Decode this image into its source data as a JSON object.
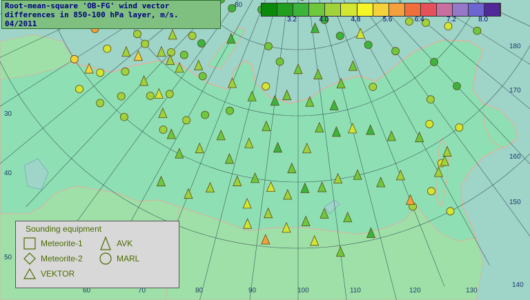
{
  "title": {
    "line1": "Root-mean-square 'OB-FG' wind vector",
    "line2": "differences in 850-100 hPa layer, m/s.",
    "line3": "04/2011"
  },
  "scale": {
    "colors": [
      "#0a8a0a",
      "#1f9e1f",
      "#3cb43c",
      "#6ec83c",
      "#a0d23c",
      "#d2e632",
      "#f5f528",
      "#f5d23c",
      "#f5a03c",
      "#f06e3c",
      "#e6505a",
      "#c86ea0",
      "#9678c8",
      "#6e64d2",
      "#50289a"
    ],
    "labels": [
      "3.2",
      "4.0",
      "4.8",
      "5.6",
      "6.4",
      "7.2",
      "8.0"
    ]
  },
  "geo_labels": {
    "lon": [
      "30",
      "40",
      "50",
      "60",
      "70",
      "80",
      "90",
      "100",
      "110",
      "120",
      "130",
      "140",
      "150",
      "160",
      "170",
      "180"
    ],
    "lat": [
      "80",
      "40",
      "50"
    ]
  },
  "legend": {
    "title": "Sounding equipment",
    "meteorite1": "Meteorite-1",
    "meteorite2": "Meteorite-2",
    "vektor": "VEKTOR",
    "avk": "AVK",
    "marl": "MARL"
  },
  "stations": {
    "circles": [
      {
        "lon": 20,
        "lat": 75,
        "c": "#3cb43c"
      },
      {
        "lon": 95,
        "lat": 80,
        "c": "#6e3cb4"
      },
      {
        "lon": 57,
        "lat": 80,
        "c": "#3cb43c"
      },
      {
        "lon": 60,
        "lat": 77,
        "c": "#3cb43c"
      },
      {
        "lon": 55,
        "lat": 77,
        "c": "#3cb43c"
      },
      {
        "lon": 50,
        "lat": 73,
        "c": "#3cb43c"
      },
      {
        "lon": 45,
        "lat": 75,
        "c": "#6ec83c"
      },
      {
        "lon": 40,
        "lat": 73,
        "c": "#3cb43c"
      },
      {
        "lon": 35,
        "lat": 72,
        "c": "#6ec83c"
      },
      {
        "lon": 70,
        "lat": 75,
        "c": "#3cb43c"
      },
      {
        "lon": 82,
        "lat": 70,
        "c": "#6ec83c"
      },
      {
        "lon": 104,
        "lat": 78,
        "c": "#3cb43c"
      },
      {
        "lon": 120,
        "lat": 74,
        "c": "#3cb43c"
      },
      {
        "lon": 127,
        "lat": 71,
        "c": "#3cb43c"
      },
      {
        "lon": 140,
        "lat": 68,
        "c": "#3cb43c"
      },
      {
        "lon": 150,
        "lat": 65,
        "c": "#6ec83c"
      },
      {
        "lon": 170,
        "lat": 65,
        "c": "#a0d23c"
      },
      {
        "lon": 165,
        "lat": 67,
        "c": "#a0d23c"
      },
      {
        "lon": 175,
        "lat": 62,
        "c": "#d2e632"
      },
      {
        "lon": 180,
        "lat": 58,
        "c": "#6ec83c"
      },
      {
        "lon": 160,
        "lat": 60,
        "c": "#3cb43c"
      },
      {
        "lon": 150,
        "lat": 56,
        "c": "#a0d23c"
      },
      {
        "lon": 160,
        "lat": 55,
        "c": "#3cb43c"
      },
      {
        "lon": 145,
        "lat": 53,
        "c": "#d2e632"
      },
      {
        "lon": 152,
        "lat": 50,
        "c": "#d2e632"
      },
      {
        "lon": 142,
        "lat": 47,
        "c": "#d2e632"
      },
      {
        "lon": 136,
        "lat": 44,
        "c": "#d2e632"
      },
      {
        "lon": 138,
        "lat": 40,
        "c": "#d2e632"
      },
      {
        "lon": 130,
        "lat": 43,
        "c": "#a0d23c"
      },
      {
        "lon": 40,
        "lat": 62,
        "c": "#a0d23c"
      },
      {
        "lon": 30,
        "lat": 60,
        "c": "#a0d23c"
      },
      {
        "lon": 33,
        "lat": 55,
        "c": "#a0d23c"
      },
      {
        "lon": 38,
        "lat": 52,
        "c": "#a0d23c"
      },
      {
        "lon": 28,
        "lat": 48,
        "c": "#d2e632"
      },
      {
        "lon": 35,
        "lat": 49,
        "c": "#a0d23c"
      },
      {
        "lon": 43,
        "lat": 50,
        "c": "#a0d23c"
      },
      {
        "lon": 45,
        "lat": 55,
        "c": "#a0d23c"
      },
      {
        "lon": 50,
        "lat": 57,
        "c": "#a0d23c"
      },
      {
        "lon": 55,
        "lat": 52,
        "c": "#a0d23c"
      },
      {
        "lon": 60,
        "lat": 55,
        "c": "#a0d23c"
      },
      {
        "lon": 65,
        "lat": 57,
        "c": "#6ec83c"
      },
      {
        "lon": 73,
        "lat": 59,
        "c": "#6ec83c"
      },
      {
        "lon": 85,
        "lat": 64,
        "c": "#d2e632"
      },
      {
        "lon": 90,
        "lat": 68,
        "c": "#6ec83c"
      },
      {
        "lon": 57,
        "lat": 62,
        "c": "#6ec83c"
      },
      {
        "lon": 48,
        "lat": 66,
        "c": "#3cb43c"
      },
      {
        "lon": 45,
        "lat": 63,
        "c": "#6ec83c"
      },
      {
        "lon": 42,
        "lat": 66,
        "c": "#a0d23c"
      },
      {
        "lon": 38,
        "lat": 70,
        "c": "#6ec83c"
      },
      {
        "lon": 30,
        "lat": 66,
        "c": "#a0d23c"
      },
      {
        "lon": 25,
        "lat": 60,
        "c": "#a0d23c"
      },
      {
        "lon": 23,
        "lat": 55,
        "c": "#d2e632"
      },
      {
        "lon": 20,
        "lat": 50,
        "c": "#f5d23c"
      },
      {
        "lon": 28,
        "lat": 52,
        "c": "#d2e632"
      },
      {
        "lon": 15,
        "lat": 55,
        "c": "#f5a03c"
      },
      {
        "lon": 133,
        "lat": 62,
        "c": "#a0d23c"
      }
    ],
    "triangles": [
      {
        "lon": 18,
        "lat": 71,
        "c": "#6ec83c"
      },
      {
        "lon": 40,
        "lat": 70,
        "c": "#3cb43c"
      },
      {
        "lon": 45,
        "lat": 70,
        "c": "#3cb43c"
      },
      {
        "lon": 32,
        "lat": 70,
        "c": "#a0d23c"
      },
      {
        "lon": 37,
        "lat": 68,
        "c": "#a0d23c"
      },
      {
        "lon": 35,
        "lat": 64,
        "c": "#a0d23c"
      },
      {
        "lon": 60,
        "lat": 69,
        "c": "#3cb43c"
      },
      {
        "lon": 112,
        "lat": 73,
        "c": "#3cb43c"
      },
      {
        "lon": 139,
        "lat": 70,
        "c": "#d2e632"
      },
      {
        "lon": 100,
        "lat": 67,
        "c": "#6ec83c"
      },
      {
        "lon": 110,
        "lat": 66,
        "c": "#6ec83c"
      },
      {
        "lon": 120,
        "lat": 64,
        "c": "#6ec83c"
      },
      {
        "lon": 128,
        "lat": 66,
        "c": "#6ec83c"
      },
      {
        "lon": 95,
        "lat": 63,
        "c": "#6ec83c"
      },
      {
        "lon": 105,
        "lat": 62,
        "c": "#6ec83c"
      },
      {
        "lon": 115,
        "lat": 61,
        "c": "#3cb43c"
      },
      {
        "lon": 90,
        "lat": 62,
        "c": "#3cb43c"
      },
      {
        "lon": 80,
        "lat": 62,
        "c": "#6ec83c"
      },
      {
        "lon": 70,
        "lat": 63,
        "c": "#a0d23c"
      },
      {
        "lon": 53,
        "lat": 63,
        "c": "#a0d23c"
      },
      {
        "lon": 47,
        "lat": 61,
        "c": "#a0d23c"
      },
      {
        "lon": 42,
        "lat": 61,
        "c": "#a0d23c"
      },
      {
        "lon": 37,
        "lat": 61,
        "c": "#a0d23c"
      },
      {
        "lon": 32,
        "lat": 58,
        "c": "#f5d23c"
      },
      {
        "lon": 28,
        "lat": 57,
        "c": "#a0d23c"
      },
      {
        "lon": 25,
        "lat": 51,
        "c": "#f5d23c"
      },
      {
        "lon": 40,
        "lat": 56,
        "c": "#a0d23c"
      },
      {
        "lon": 47,
        "lat": 56,
        "c": "#d2e632"
      },
      {
        "lon": 52,
        "lat": 54,
        "c": "#a0d23c"
      },
      {
        "lon": 58,
        "lat": 52,
        "c": "#6ec83c"
      },
      {
        "lon": 63,
        "lat": 50,
        "c": "#6ec83c"
      },
      {
        "lon": 68,
        "lat": 52,
        "c": "#a0d23c"
      },
      {
        "lon": 73,
        "lat": 55,
        "c": "#6ec83c"
      },
      {
        "lon": 78,
        "lat": 52,
        "c": "#6ec83c"
      },
      {
        "lon": 83,
        "lat": 55,
        "c": "#a0d23c"
      },
      {
        "lon": 88,
        "lat": 58,
        "c": "#6ec83c"
      },
      {
        "lon": 93,
        "lat": 55,
        "c": "#3cb43c"
      },
      {
        "lon": 98,
        "lat": 52,
        "c": "#6ec83c"
      },
      {
        "lon": 103,
        "lat": 55,
        "c": "#a0d23c"
      },
      {
        "lon": 108,
        "lat": 58,
        "c": "#6ec83c"
      },
      {
        "lon": 114,
        "lat": 57,
        "c": "#3cb43c"
      },
      {
        "lon": 120,
        "lat": 57,
        "c": "#d2e632"
      },
      {
        "lon": 126,
        "lat": 56,
        "c": "#3cb43c"
      },
      {
        "lon": 132,
        "lat": 54,
        "c": "#6ec83c"
      },
      {
        "lon": 82,
        "lat": 49,
        "c": "#a0d23c"
      },
      {
        "lon": 87,
        "lat": 50,
        "c": "#6ec83c"
      },
      {
        "lon": 92,
        "lat": 49,
        "c": "#d2e632"
      },
      {
        "lon": 97,
        "lat": 48,
        "c": "#a0d23c"
      },
      {
        "lon": 102,
        "lat": 49,
        "c": "#3cb43c"
      },
      {
        "lon": 107,
        "lat": 49,
        "c": "#6ec83c"
      },
      {
        "lon": 112,
        "lat": 50,
        "c": "#a0d23c"
      },
      {
        "lon": 118,
        "lat": 50,
        "c": "#6ec83c"
      },
      {
        "lon": 124,
        "lat": 48,
        "c": "#6ec83c"
      },
      {
        "lon": 130,
        "lat": 48,
        "c": "#a0d23c"
      },
      {
        "lon": 140,
        "lat": 52,
        "c": "#6ec83c"
      },
      {
        "lon": 145,
        "lat": 48,
        "c": "#a0d23c"
      },
      {
        "lon": 86,
        "lat": 46,
        "c": "#d2e632"
      },
      {
        "lon": 92,
        "lat": 45,
        "c": "#a0d23c"
      },
      {
        "lon": 97,
        "lat": 43,
        "c": "#d2e632"
      },
      {
        "lon": 102,
        "lat": 44,
        "c": "#6ec83c"
      },
      {
        "lon": 107,
        "lat": 45,
        "c": "#6ec83c"
      },
      {
        "lon": 113,
        "lat": 44,
        "c": "#6ec83c"
      },
      {
        "lon": 87,
        "lat": 43,
        "c": "#d2e632"
      },
      {
        "lon": 92,
        "lat": 41,
        "c": "#f5a03c"
      },
      {
        "lon": 104,
        "lat": 41,
        "c": "#d2e632"
      },
      {
        "lon": 110,
        "lat": 39,
        "c": "#6ec83c"
      },
      {
        "lon": 118,
        "lat": 41,
        "c": "#3cb43c"
      },
      {
        "lon": 130,
        "lat": 44,
        "c": "#f5a03c"
      },
      {
        "lon": 140,
        "lat": 46,
        "c": "#a0d23c"
      },
      {
        "lon": 62,
        "lat": 45,
        "c": "#6ec83c"
      },
      {
        "lon": 70,
        "lat": 45,
        "c": "#a0d23c"
      },
      {
        "lon": 75,
        "lat": 47,
        "c": "#a0d23c"
      },
      {
        "lon": 143,
        "lat": 47,
        "c": "#a0d23c"
      }
    ]
  }
}
